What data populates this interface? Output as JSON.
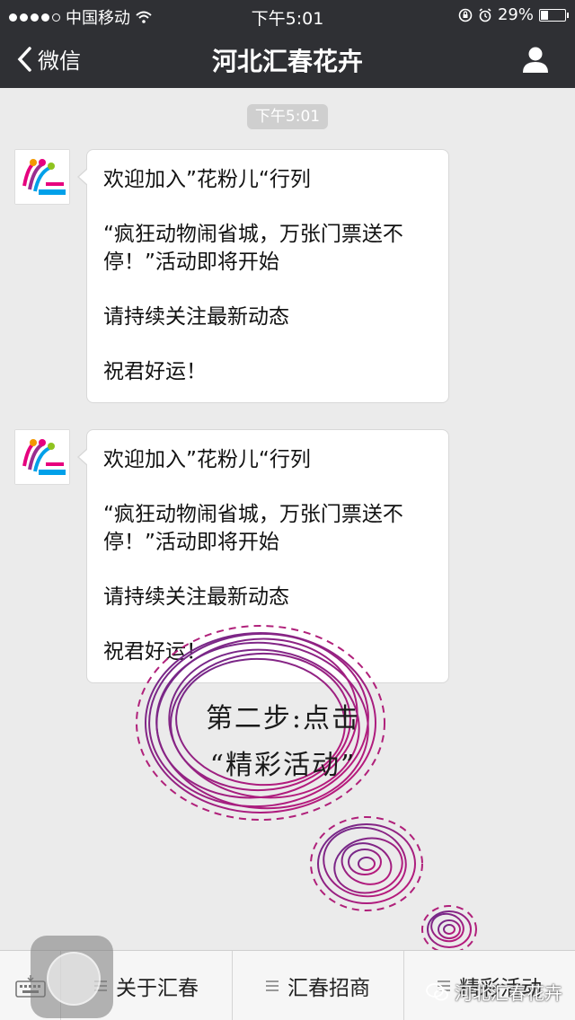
{
  "status": {
    "carrier": "中国移动",
    "time": "下午5:01",
    "battery": "29%",
    "battery_level": 0.29
  },
  "nav": {
    "back_label": "微信",
    "title": "河北汇春花卉"
  },
  "chat": {
    "timestamp": "下午5:01",
    "messages": [
      {
        "lines": [
          "欢迎加入”花粉儿“行列",
          "“疯狂动物闹省城，万张门票送不停！”活动即将开始",
          "请持续关注最新动态",
          "祝君好运！"
        ]
      },
      {
        "lines": [
          "欢迎加入”花粉儿“行列",
          "“疯狂动物闹省城，万张门票送不停！”活动即将开始",
          "请持续关注最新动态",
          "祝君好运！"
        ]
      }
    ]
  },
  "overlay": {
    "line1": "第二步:点击",
    "line2": "“精彩活动”"
  },
  "menu": {
    "items": [
      "关于汇春",
      "汇春招商",
      "精彩活动"
    ]
  },
  "watermark": "河北汇春花卉",
  "colors": {
    "topbar": "#2f3034",
    "background": "#ebebeb",
    "doodle": "#a0207a"
  }
}
